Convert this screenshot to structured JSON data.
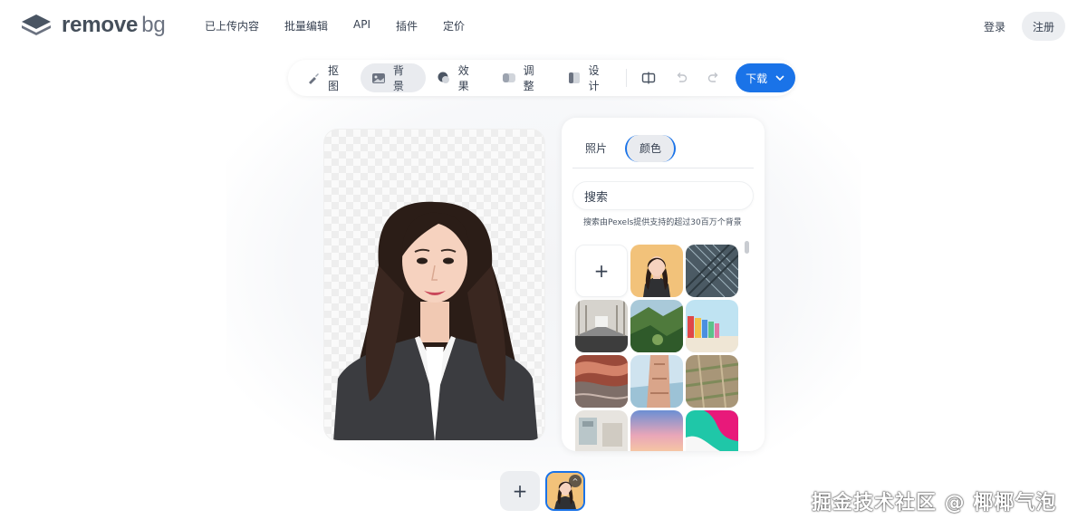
{
  "header": {
    "logo_main": "remove",
    "logo_sub": "bg",
    "nav": [
      "已上传内容",
      "批量编辑",
      "API",
      "插件",
      "定价"
    ],
    "login": "登录",
    "register": "注册"
  },
  "toolbar": {
    "tools": [
      {
        "label": "抠图",
        "icon": "brush-icon"
      },
      {
        "label": "背景",
        "icon": "image-icon",
        "active": true
      },
      {
        "label": "效果",
        "icon": "effects-icon"
      },
      {
        "label": "调整",
        "icon": "adjust-icon"
      },
      {
        "label": "设计",
        "icon": "design-icon"
      }
    ],
    "compare_icon": "compare-icon",
    "undo_icon": "undo-icon",
    "redo_icon": "redo-icon",
    "download_label": "下载"
  },
  "panel": {
    "tabs": [
      {
        "label": "照片",
        "active": false
      },
      {
        "label": "颜色",
        "active": true
      }
    ],
    "search_placeholder": "搜索",
    "search_note": "搜索由Pexels提供支持的超过30百万个背景",
    "add_label": "+"
  },
  "bottom": {
    "add_label": "+"
  },
  "watermark": "掘金技术社区 @ 椰椰气泡",
  "colors": {
    "accent": "#1a73e8",
    "active_tab_bg": "#e9ebef"
  }
}
